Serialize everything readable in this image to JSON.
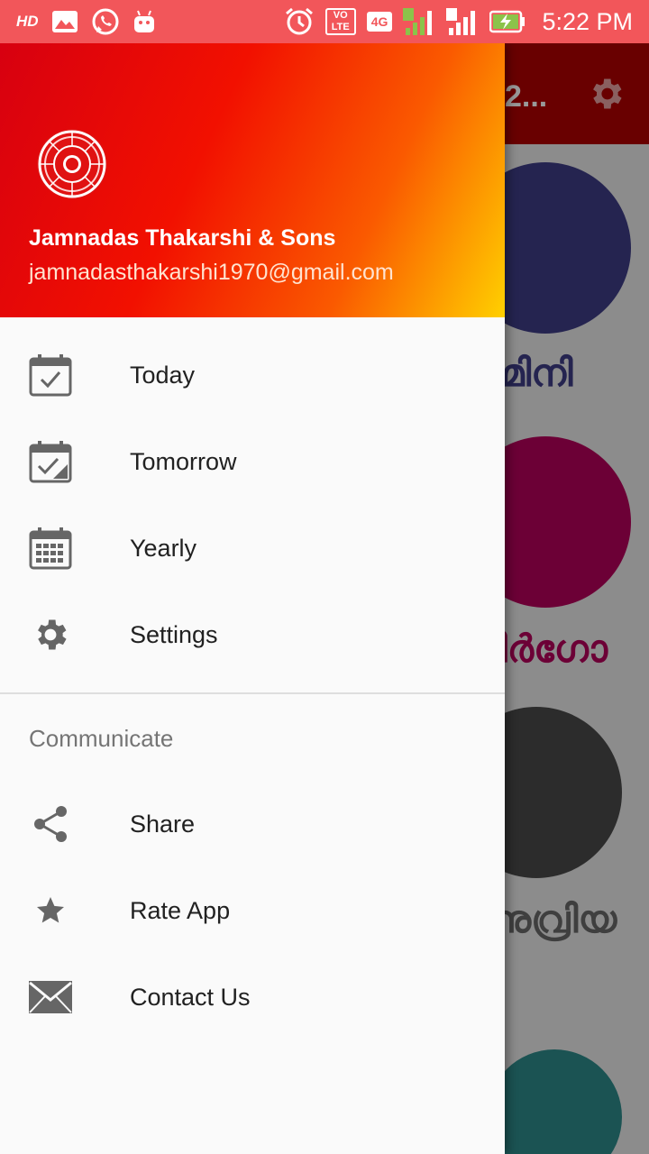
{
  "status_bar": {
    "left_icons": [
      "hd-icon",
      "gallery-icon",
      "whatsapp-icon",
      "android-icon"
    ],
    "hd_text": "HD",
    "right_icons": [
      "alarm-icon",
      "volte-icon",
      "4g-icon",
      "signal-sim1-icon",
      "signal-sim2-icon",
      "battery-charging-icon"
    ],
    "volte_text": "VO LTE",
    "network_text": "4G",
    "time": "5:22 PM"
  },
  "background_app": {
    "title": "2...",
    "toolbar_color": "#b00000",
    "signs": [
      {
        "icon": "gemini-icon",
        "label": "ജമിനി",
        "color": "#3f3d86"
      },
      {
        "icon": "virgo-icon",
        "label": "ിർഗോ",
        "color": "#b5005a"
      },
      {
        "icon": "sagittarius-icon",
        "label": "ദനുവ്രിയ",
        "color": "#4a4a4a"
      }
    ]
  },
  "drawer": {
    "header": {
      "logo_icon": "zodiac-wheel-logo-icon",
      "name": "Jamnadas Thakarshi & Sons",
      "email": "jamnadasthakarshi1970@gmail.com"
    },
    "items": [
      {
        "label": "Today",
        "icon": "calendar-check-icon"
      },
      {
        "label": "Tomorrow",
        "icon": "calendar-tomorrow-icon"
      },
      {
        "label": "Yearly",
        "icon": "calendar-grid-icon"
      },
      {
        "label": "Settings",
        "icon": "gear-icon"
      }
    ],
    "section_title": "Communicate",
    "communicate_items": [
      {
        "label": "Share",
        "icon": "share-icon"
      },
      {
        "label": "Rate App",
        "icon": "star-icon"
      },
      {
        "label": "Contact Us",
        "icon": "mail-icon"
      }
    ]
  },
  "colors": {
    "status_bar": "#f2565a",
    "header_gradient": [
      "#d70010",
      "#f21000",
      "#fa5a00",
      "#ffd000"
    ],
    "icon_gray": "#666666",
    "text_dark": "#212121"
  }
}
